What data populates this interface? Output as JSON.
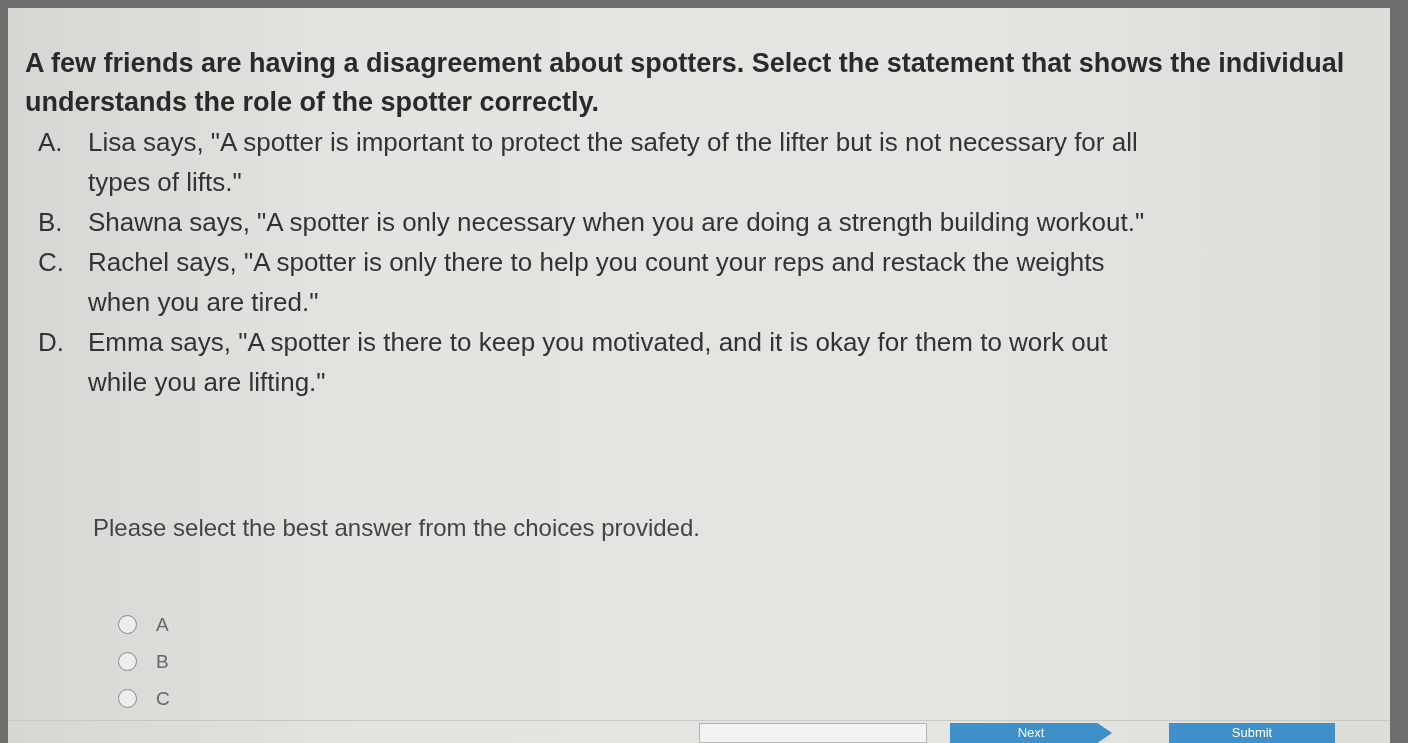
{
  "question": {
    "text": "A few friends are having a disagreement about spotters. Select the statement that shows the individual understands the role of the spotter correctly.",
    "options": [
      {
        "letter": "A.",
        "text": "Lisa says, \"A spotter is important to protect the safety of the lifter but is not necessary for all types of lifts.\""
      },
      {
        "letter": "B.",
        "text": "Shawna says, \"A spotter is only necessary when you are doing a strength building workout.\""
      },
      {
        "letter": "C.",
        "text": "Rachel says, \"A spotter is only there to help you count your reps and restack the weights when you are tired.\""
      },
      {
        "letter": "D.",
        "text": "Emma says, \"A spotter is there to keep you motivated, and it is okay for them to work out while you are lifting.\""
      }
    ]
  },
  "instruction": "Please select the best answer from the choices provided.",
  "answer_choices": [
    {
      "label": "A",
      "selected": false
    },
    {
      "label": "B",
      "selected": false
    },
    {
      "label": "C",
      "selected": false
    }
  ],
  "buttons": [
    {
      "kind": "outline"
    },
    {
      "kind": "next",
      "label": "Next"
    },
    {
      "kind": "submit",
      "label": "Submit"
    }
  ]
}
